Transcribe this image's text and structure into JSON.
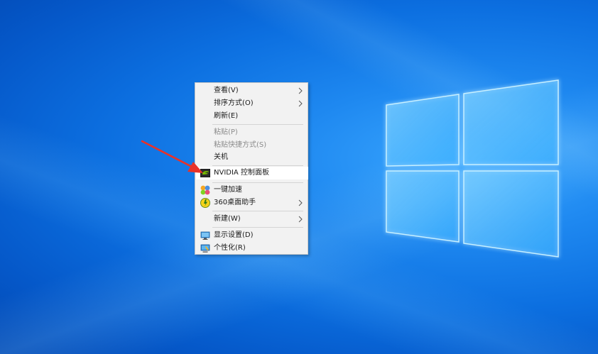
{
  "context_menu": {
    "items": [
      {
        "label": "查看(V)"
      },
      {
        "label": "排序方式(O)"
      },
      {
        "label": "刷新(E)"
      },
      {
        "label": "粘贴(P)"
      },
      {
        "label": "粘贴快捷方式(S)"
      },
      {
        "label": "关机"
      },
      {
        "label": "NVIDIA 控制面板"
      },
      {
        "label": "一键加速"
      },
      {
        "label": "360桌面助手"
      },
      {
        "label": "新建(W)"
      },
      {
        "label": "显示设置(D)"
      },
      {
        "label": "个性化(R)"
      }
    ]
  },
  "icons": {
    "nvidia": "nvidia-icon",
    "speedup": "speedup-icon",
    "assistant": "360-assistant-icon",
    "display": "display-settings-icon",
    "personalize": "personalize-icon",
    "submenu": "chevron-right-icon"
  },
  "colors": {
    "desktop": "#0c6fe0",
    "menu_bg": "#f2f2f2",
    "highlight": "#ffffff",
    "annotation_arrow": "#e8322a"
  }
}
